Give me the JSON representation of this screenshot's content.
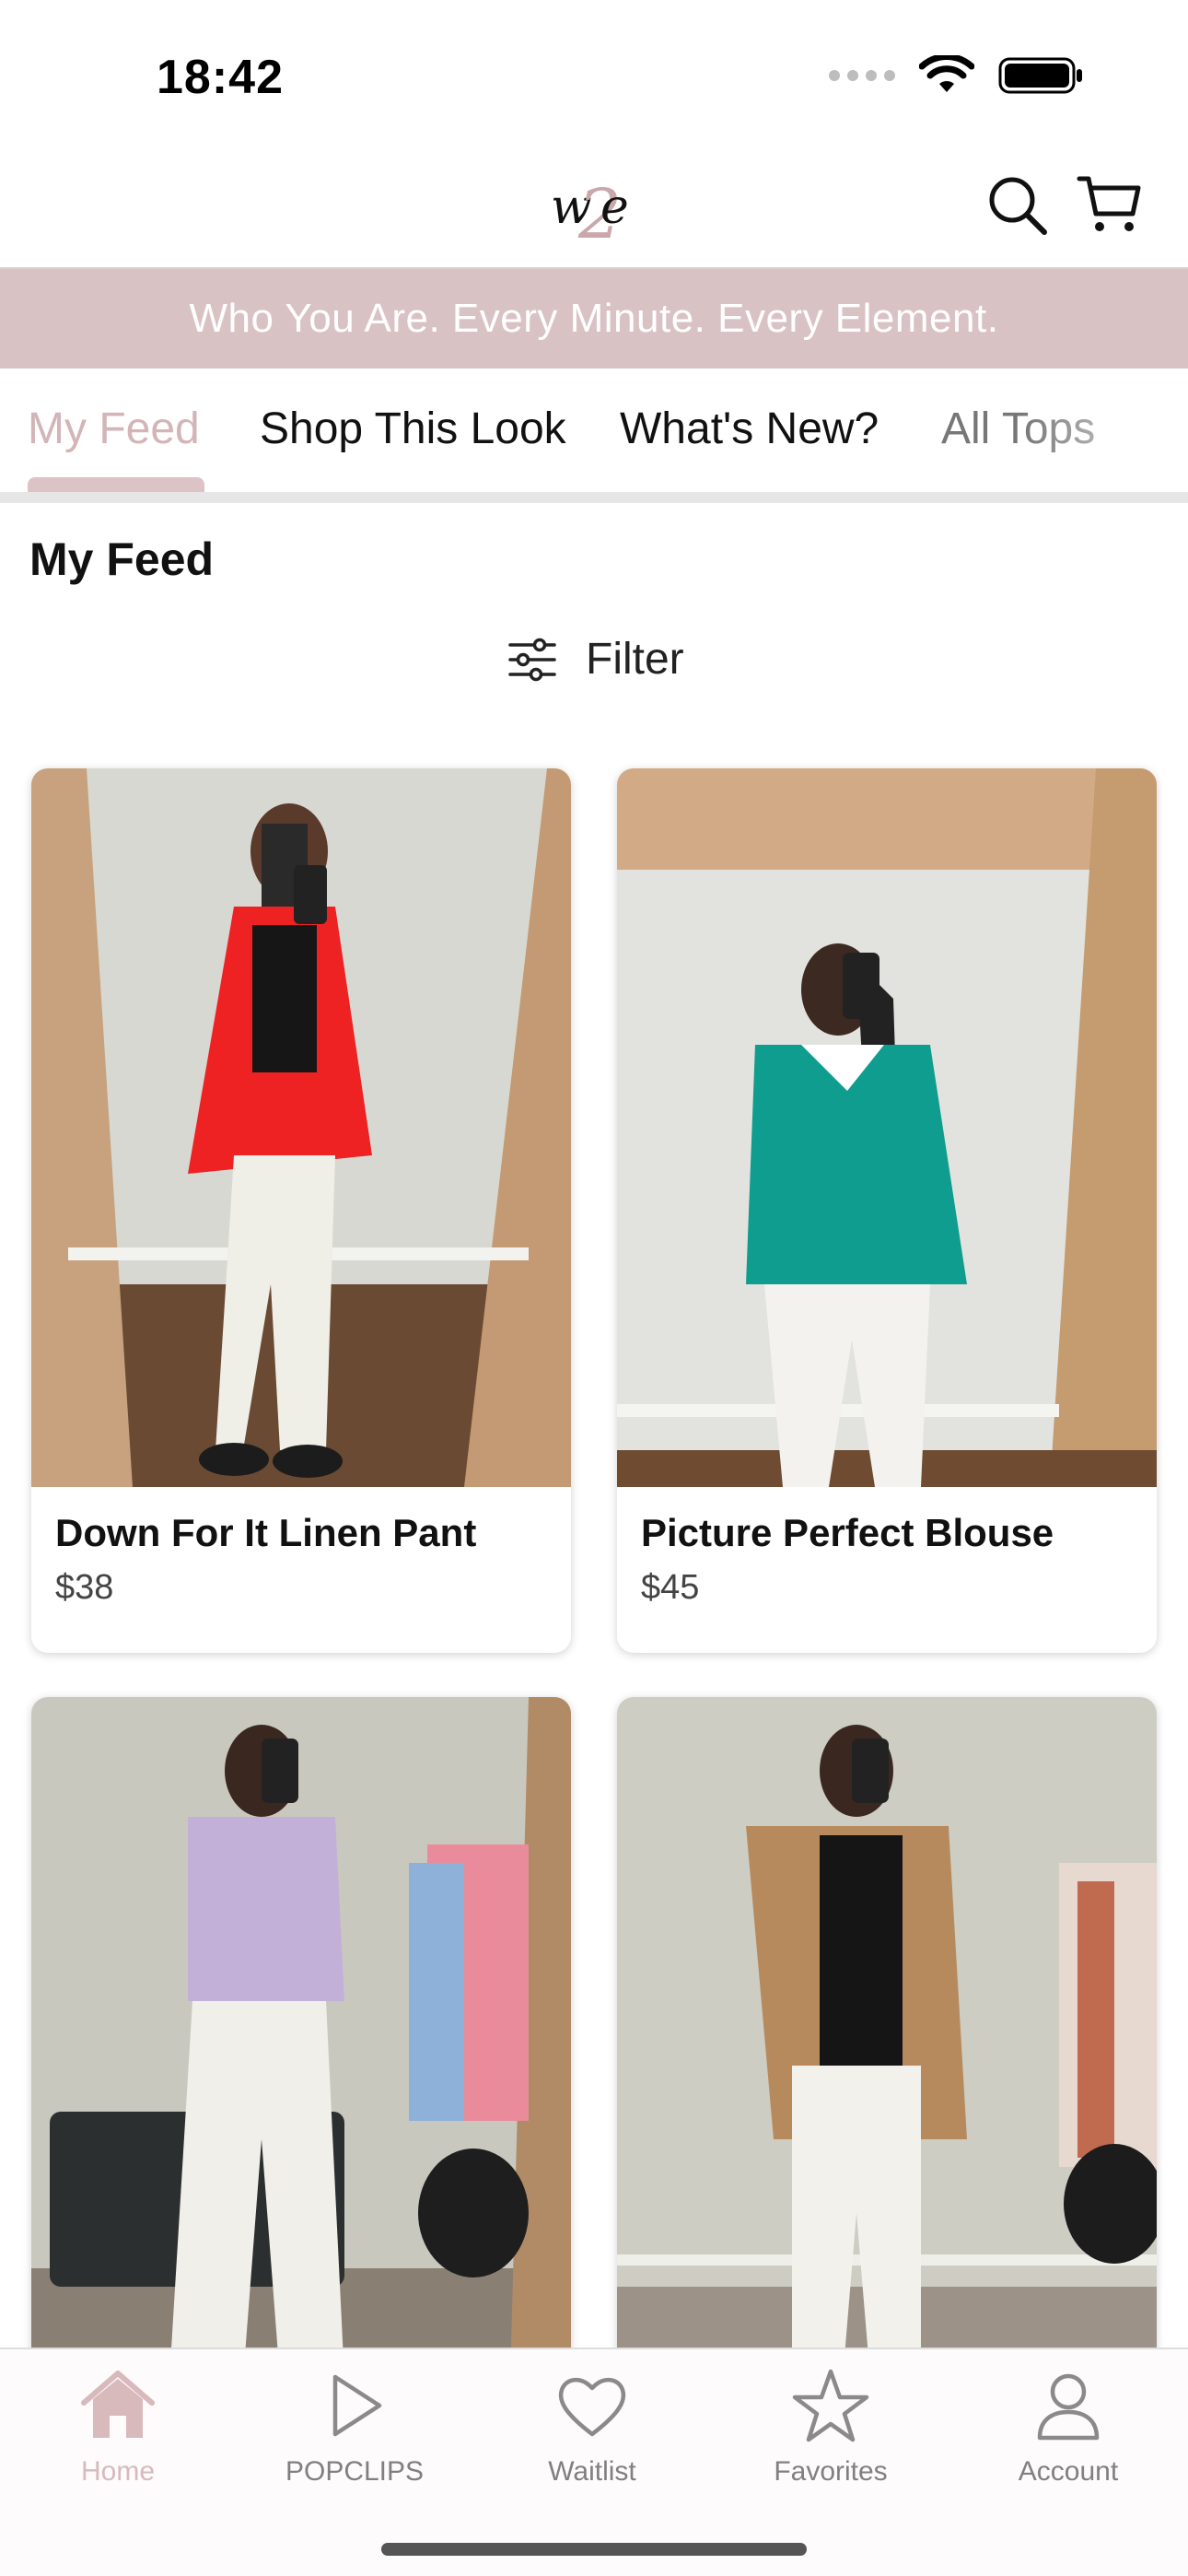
{
  "status_bar": {
    "time": "18:42"
  },
  "header": {
    "logo_text": "w2e",
    "icons": {
      "search": "search-icon",
      "cart": "cart-icon"
    }
  },
  "tagline": "Who You Are. Every Minute. Every Element.",
  "tabs": [
    {
      "label": "My Feed",
      "active": true
    },
    {
      "label": "Shop This Look",
      "active": false
    },
    {
      "label": "What's New?",
      "active": false
    },
    {
      "label": "All Tops",
      "active": false
    }
  ],
  "section_title": "My Feed",
  "filter": {
    "label": "Filter",
    "icon": "sliders-icon"
  },
  "products": [
    {
      "name": "Down For It Linen Pant",
      "price": "$38"
    },
    {
      "name": "Picture Perfect Blouse",
      "price": "$45"
    },
    {
      "name": "",
      "price": ""
    },
    {
      "name": "",
      "price": ""
    }
  ],
  "bottom_nav": [
    {
      "label": "Home",
      "icon": "home-icon",
      "active": true
    },
    {
      "label": "POPCLIPS",
      "icon": "play-icon",
      "active": false
    },
    {
      "label": "Waitlist",
      "icon": "heart-icon",
      "active": false
    },
    {
      "label": "Favorites",
      "icon": "star-icon",
      "active": false
    },
    {
      "label": "Account",
      "icon": "person-icon",
      "active": false
    }
  ],
  "colors": {
    "accent": "#d9c2c4",
    "active_tab": "#d3b4b7",
    "text": "#111111"
  }
}
